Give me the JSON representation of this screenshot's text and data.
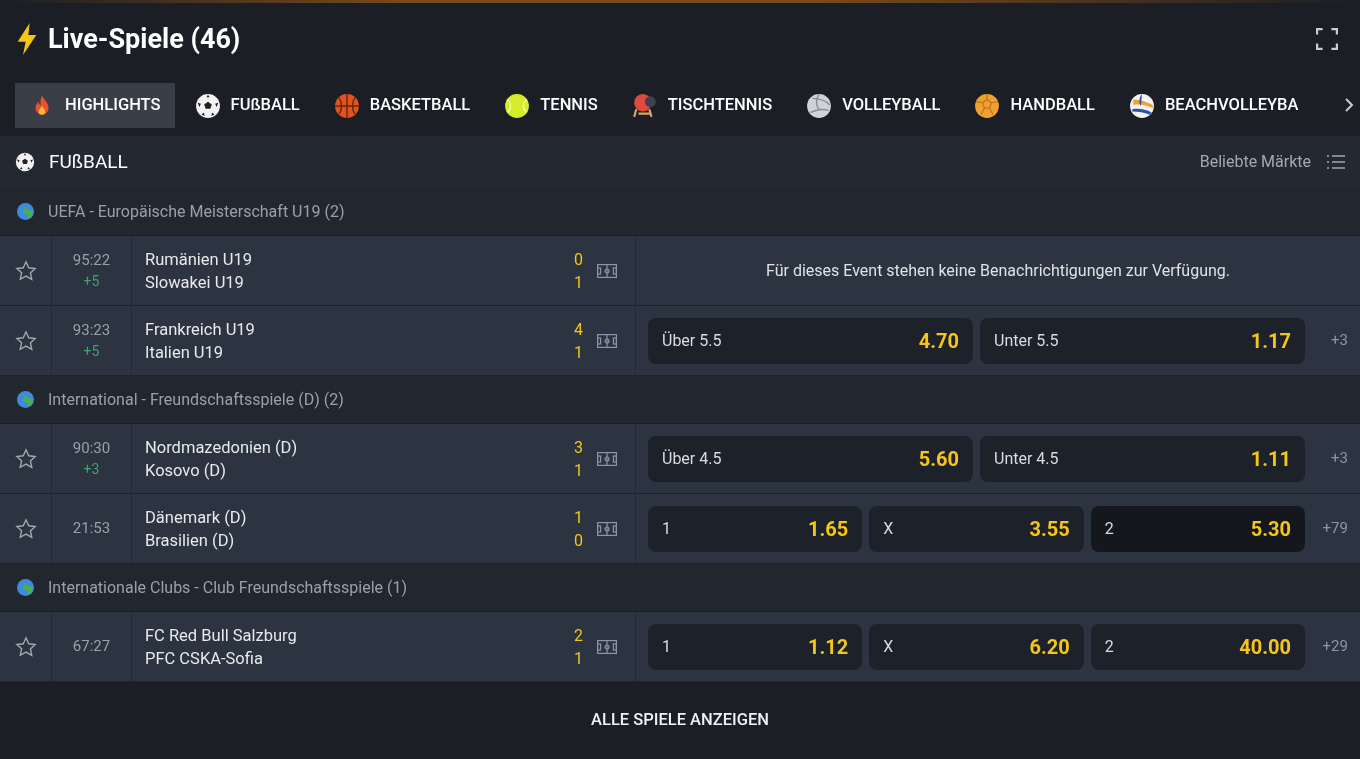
{
  "header": {
    "title": "Live-Spiele (46)"
  },
  "tabs": [
    {
      "label": "HIGHLIGHTS",
      "kind": "fire",
      "selected": true
    },
    {
      "label": "FUßBALL",
      "kind": "soccer",
      "selected": false
    },
    {
      "label": "BASKETBALL",
      "kind": "basketball",
      "selected": false
    },
    {
      "label": "TENNIS",
      "kind": "tennis",
      "selected": false
    },
    {
      "label": "TISCHTENNIS",
      "kind": "tabletennis",
      "selected": false
    },
    {
      "label": "VOLLEYBALL",
      "kind": "volleyball",
      "selected": false
    },
    {
      "label": "HANDBALL",
      "kind": "handball",
      "selected": false
    },
    {
      "label": "BEACHVOLLEYBA",
      "kind": "beachvolleyball",
      "selected": false
    }
  ],
  "section": {
    "title": "FUßBALL",
    "markets_label": "Beliebte Märkte"
  },
  "leagues": [
    {
      "name": "UEFA - Europäische Meisterschaft U19 (2)",
      "matches": [
        {
          "time": "95:22",
          "extra": "+5",
          "home": "Rumänien U19",
          "away": "Slowakei U19",
          "home_score": "0",
          "away_score": "1",
          "message": "Für dieses Event stehen keine Benachrichtigungen zur Verfügung."
        },
        {
          "time": "93:23",
          "extra": "+5",
          "home": "Frankreich U19",
          "away": "Italien U19",
          "home_score": "4",
          "away_score": "1",
          "more": "+3",
          "odds": [
            {
              "label": "Über 5.5",
              "value": "4.70",
              "selected": false
            },
            {
              "label": "Unter 5.5",
              "value": "1.17",
              "selected": false
            }
          ]
        }
      ]
    },
    {
      "name": "International - Freundschaftsspiele (D) (2)",
      "matches": [
        {
          "time": "90:30",
          "extra": "+3",
          "home": "Nordmazedonien (D)",
          "away": "Kosovo (D)",
          "home_score": "3",
          "away_score": "1",
          "more": "+3",
          "odds": [
            {
              "label": "Über 4.5",
              "value": "5.60",
              "selected": false
            },
            {
              "label": "Unter 4.5",
              "value": "1.11",
              "selected": false
            }
          ]
        },
        {
          "time": "21:53",
          "home": "Dänemark (D)",
          "away": "Brasilien (D)",
          "home_score": "1",
          "away_score": "0",
          "more": "+79",
          "odds": [
            {
              "label": "1",
              "value": "1.65",
              "selected": false
            },
            {
              "label": "X",
              "value": "3.55",
              "selected": false
            },
            {
              "label": "2",
              "value": "5.30",
              "selected": true
            }
          ]
        }
      ]
    },
    {
      "name": "Internationale Clubs - Club Freundschaftsspiele (1)",
      "matches": [
        {
          "time": "67:27",
          "home": "FC Red Bull Salzburg",
          "away": "PFC CSKA-Sofia",
          "home_score": "2",
          "away_score": "1",
          "more": "+29",
          "odds": [
            {
              "label": "1",
              "value": "1.12",
              "selected": false
            },
            {
              "label": "X",
              "value": "6.20",
              "selected": false
            },
            {
              "label": "2",
              "value": "40.00",
              "selected": false
            }
          ]
        }
      ]
    }
  ],
  "footer": {
    "link": "ALLE SPIELE ANZEIGEN"
  }
}
